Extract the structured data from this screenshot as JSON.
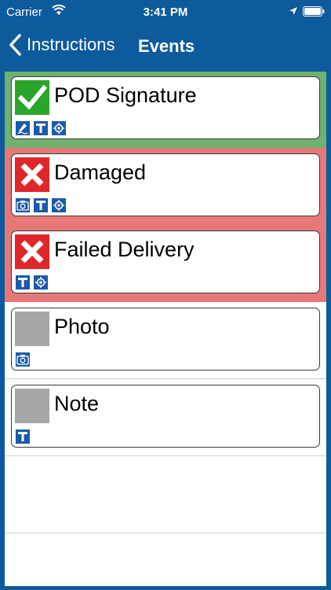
{
  "status_bar": {
    "carrier": "Carrier",
    "time": "3:41 PM"
  },
  "nav": {
    "back_label": "Instructions",
    "title": "Events"
  },
  "events": [
    {
      "label": "POD Signature",
      "status": "done",
      "icons": [
        "signature-icon",
        "text-icon",
        "location-icon"
      ],
      "band_color": "#6fb16f"
    },
    {
      "label": "Damaged",
      "status": "failed",
      "icons": [
        "camera-icon",
        "text-icon",
        "location-icon"
      ],
      "band_color": "#e67878"
    },
    {
      "label": "Failed Delivery",
      "status": "failed",
      "icons": [
        "text-icon",
        "location-icon"
      ],
      "band_color": "#e67878"
    },
    {
      "label": "Photo",
      "status": "pending",
      "icons": [
        "camera-icon"
      ],
      "band_color": "#ffffff"
    },
    {
      "label": "Note",
      "status": "pending",
      "icons": [
        "text-icon"
      ],
      "band_color": "#ffffff"
    }
  ],
  "colors": {
    "nav_bg": "#0d5a9c",
    "check_green": "#2aa52a",
    "fail_red": "#e0262a",
    "pending_gray": "#a6a6a6",
    "icon_blue": "#1d5aa8"
  }
}
